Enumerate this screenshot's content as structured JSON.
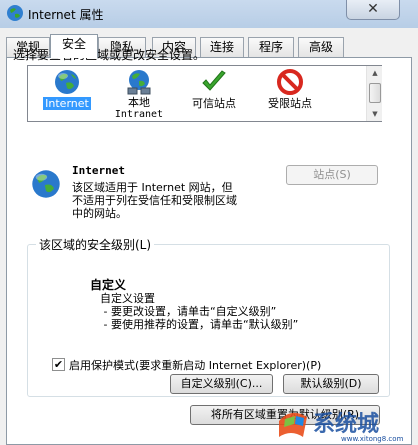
{
  "window": {
    "title": "Internet 属性",
    "close_glyph": "✕"
  },
  "tabs": [
    {
      "label": "常规",
      "active": false
    },
    {
      "label": "安全",
      "active": true
    },
    {
      "label": "隐私",
      "active": false
    },
    {
      "label": "内容",
      "active": false
    },
    {
      "label": "连接",
      "active": false
    },
    {
      "label": "程序",
      "active": false
    },
    {
      "label": "高级",
      "active": false
    }
  ],
  "security": {
    "zone_prompt": "选择要查看的区域或更改安全设置。",
    "zones": [
      {
        "name": "Internet",
        "selected": true,
        "icon": "globe-icon"
      },
      {
        "name": "本地",
        "sub": "Intranet",
        "icon": "globe-network-icon"
      },
      {
        "name": "可信站点",
        "icon": "checkmark-icon"
      },
      {
        "name": "受限站点",
        "icon": "prohibited-icon"
      }
    ],
    "zone_info": {
      "title": "Internet",
      "description": "该区域适用于 Internet 网站，但\n不适用于列在受信任和受限制区域\n中的网站。"
    },
    "sites_button": "站点(S)",
    "level_group_label": "该区域的安全级别(L)",
    "level": {
      "name": "自定义",
      "description": "自定义设置\n - 要更改设置，请单击“自定义级别”\n - 要使用推荐的设置，请单击“默认级别”"
    },
    "protected_mode": {
      "label": "启用保护模式(要求重新启动 Internet Explorer)(P)",
      "checked": true,
      "check_glyph": "✔"
    },
    "custom_level_button": "自定义级别(C)...",
    "default_level_button": "默认级别(D)",
    "reset_all_button": "将所有区域重置为默认级别(R)"
  },
  "watermark": {
    "text": "系统城",
    "url": "www.xitong8.com"
  },
  "colors": {
    "selection": "#3399ff",
    "check_green": "#3aa52e",
    "prohibit_red": "#d8281f"
  }
}
